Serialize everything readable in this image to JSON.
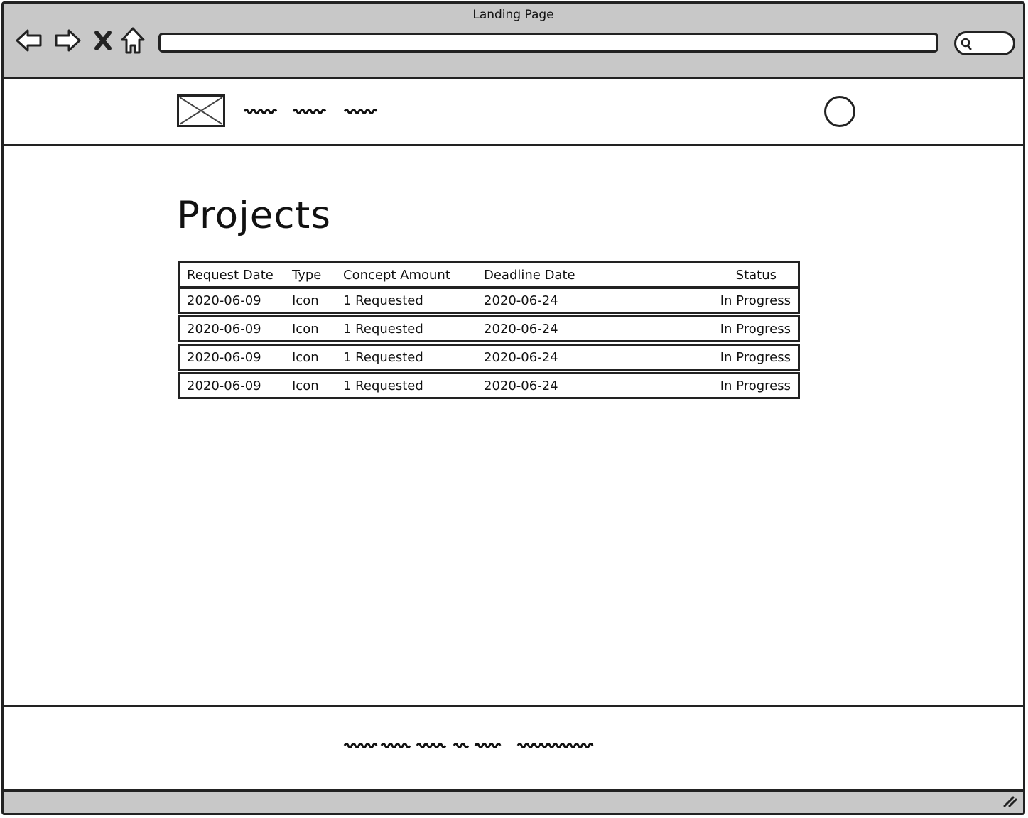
{
  "window": {
    "title": "Landing Page"
  },
  "toolbar": {
    "back_icon": "arrow-left-icon",
    "forward_icon": "arrow-right-icon",
    "stop_icon": "close-icon",
    "home_icon": "home-icon",
    "url_value": "",
    "search_icon": "search-icon"
  },
  "header": {
    "logo": "image-placeholder-icon",
    "nav_items": [
      "scribble",
      "scribble",
      "scribble"
    ],
    "avatar": "user-avatar"
  },
  "main": {
    "title": "Projects",
    "table": {
      "columns": [
        "Request Date",
        "Type",
        "Concept Amount",
        "Deadline Date",
        "Status"
      ],
      "rows": [
        [
          "2020-06-09",
          "Icon",
          "1 Requested",
          "2020-06-24",
          "In Progress"
        ],
        [
          "2020-06-09",
          "Icon",
          "1 Requested",
          "2020-06-24",
          "In Progress"
        ],
        [
          "2020-06-09",
          "Icon",
          "1 Requested",
          "2020-06-24",
          "In Progress"
        ],
        [
          "2020-06-09",
          "Icon",
          "1 Requested",
          "2020-06-24",
          "In Progress"
        ]
      ]
    }
  },
  "colors": {
    "chrome": "#c8c8c8",
    "ink": "#222222",
    "background": "#ffffff"
  }
}
